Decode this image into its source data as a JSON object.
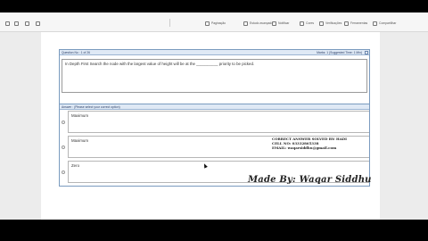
{
  "toolbar": {
    "items": [
      "Paginação",
      "Estudo avançado",
      "Notificar",
      "Cores",
      "Verificações",
      "Ferramentas",
      "Compartilhar"
    ]
  },
  "question": {
    "number_label": "Question No : 1 of 26",
    "marks_label": "Marks: 1 (Suggested Time: 1 Min)",
    "text": "In Depth First Search the node with the largest value of height will be at the __________ priority to be picked."
  },
  "answer": {
    "header": "Answer : (Please select your correct option)",
    "options": [
      "Maximum",
      "Maximum",
      "Zero"
    ]
  },
  "watermark": {
    "line1": "CORRECT ANSWER SOLVED BY: HADI",
    "line2": "CELL NO: 03332865338",
    "line3": "EMAIL: waqarsiddhu@gmail.com",
    "made_by": "Made By: Waqar Siddhu"
  }
}
